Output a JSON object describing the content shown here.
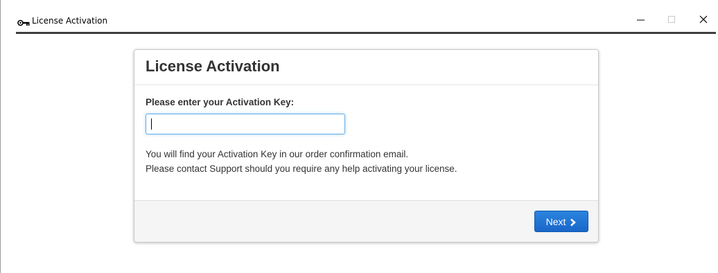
{
  "window": {
    "title": "License Activation",
    "icons": {
      "app": "key-icon",
      "minimize": "minimize-icon",
      "maximize": "maximize-icon",
      "close": "close-icon"
    }
  },
  "panel": {
    "heading": "License Activation",
    "field_label": "Please enter your Activation Key:",
    "activation_key": {
      "value": "",
      "placeholder": ""
    },
    "help_lines": [
      "You will find your Activation Key in our order confirmation email.",
      "Please contact Support should you require any help activating your license."
    ],
    "next_button": {
      "label": "Next",
      "icon": "chevron-right-icon"
    }
  },
  "colors": {
    "accent": "#1a66c9",
    "title_rule": "#3f3f3f",
    "focus_border": "#66afe9",
    "footer_bg": "#f5f5f5"
  }
}
